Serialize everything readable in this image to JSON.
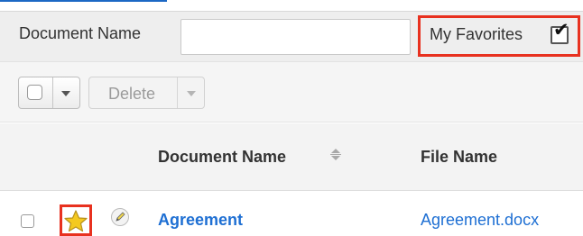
{
  "filter": {
    "document_name_label": "Document Name",
    "document_name_value": "",
    "favorites_label": "My Favorites",
    "favorites_checked": true
  },
  "actions": {
    "delete_label": "Delete"
  },
  "table": {
    "columns": [
      "Document Name",
      "File Name"
    ],
    "rows": [
      {
        "document_name": "Agreement",
        "file_name": "Agreement.docx",
        "favorite": true
      }
    ]
  },
  "colors": {
    "link": "#1e6fd3",
    "highlight": "#e8311f",
    "star": "#f4c91f"
  },
  "icons": [
    "checkbox-icon",
    "chevron-down-icon",
    "sort-icon",
    "star-icon",
    "pencil-icon"
  ]
}
